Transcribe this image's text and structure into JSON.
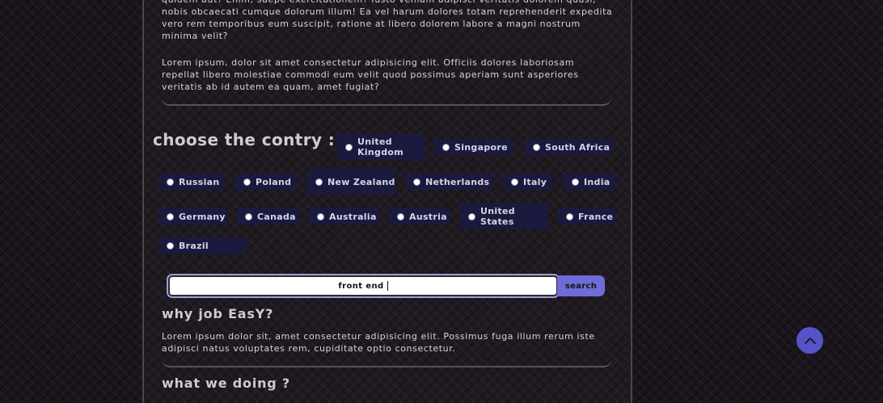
{
  "content": {
    "para1": "quidem aut? Enim, saepe exercitationem? Iusto veniam adipisci veritatis dolorem quasi, nobis obcaecati cumque dolorum illum! Ea vel harum dolores totam reprehenderit expedita vero rem temporibus eum suscipit, ratione at libero dolorem labore a magni nostrum minima velit?",
    "para2": "Lorem ipsum, dolor sit amet consectetur adipisicing elit. Officiis dolores laboriosam repellat libero molestiae commodi eum velit quod possimus aperiam sunt asperiores veritatis ab id autem ea quam, amet fugiat?"
  },
  "countries": {
    "title": "choose the contry :",
    "items": [
      "United Kingdom",
      "Singapore",
      "South Africa",
      "Russian",
      "Poland",
      "New Zealand",
      "Netherlands",
      "Italy",
      "India",
      "Germany",
      "Canada",
      "Australia",
      "Austria",
      "United States",
      "France",
      "Brazil"
    ]
  },
  "search": {
    "value": "front end",
    "button_label": "search"
  },
  "why": {
    "title": "why job EasY?",
    "text": "Lorem ipsum dolor sit, amet consectetur adipisicing elit. Possimus fuga illum rerum iste adipisci natus voluptates rem, cupiditate optio consectetur."
  },
  "what": {
    "title": "what we doing ?"
  },
  "icons": {
    "scroll_top": "chevron-up-icon",
    "radio": "radio-dot-icon"
  },
  "colors": {
    "accent": "#6f6bd8",
    "chip_bg": "#1a1a3e",
    "scroll_top_bg": "#5754c9"
  }
}
